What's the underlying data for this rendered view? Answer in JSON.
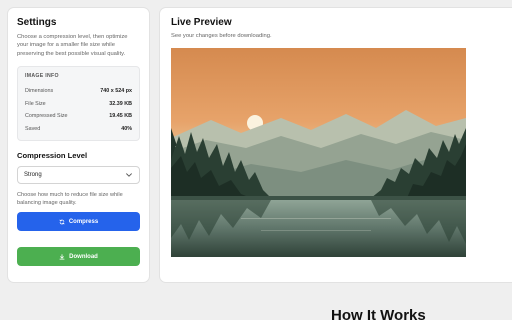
{
  "settings": {
    "title": "Settings",
    "description": "Choose a compression level, then optimize your image for a smaller file size while preserving the best possible visual quality.",
    "image_info": {
      "heading": "IMAGE INFO",
      "rows": [
        {
          "label": "Dimensions",
          "value": "740 x 524 px"
        },
        {
          "label": "File Size",
          "value": "32.39 KB"
        },
        {
          "label": "Compressed Size",
          "value": "19.45 KB"
        },
        {
          "label": "Saved",
          "value": "40%"
        }
      ]
    },
    "compression": {
      "label": "Compression Level",
      "selected": "Strong",
      "hint": "Choose how much to reduce file size while balancing image quality."
    },
    "compress_button": {
      "label": "Compress",
      "icon": "refresh-icon",
      "color": "#2563eb"
    },
    "download_button": {
      "label": "Download",
      "icon": "download-icon",
      "color": "#4caf50"
    }
  },
  "preview": {
    "title": "Live Preview",
    "description": "See your changes before downloading."
  },
  "how_it_works": {
    "title": "How It Works"
  }
}
